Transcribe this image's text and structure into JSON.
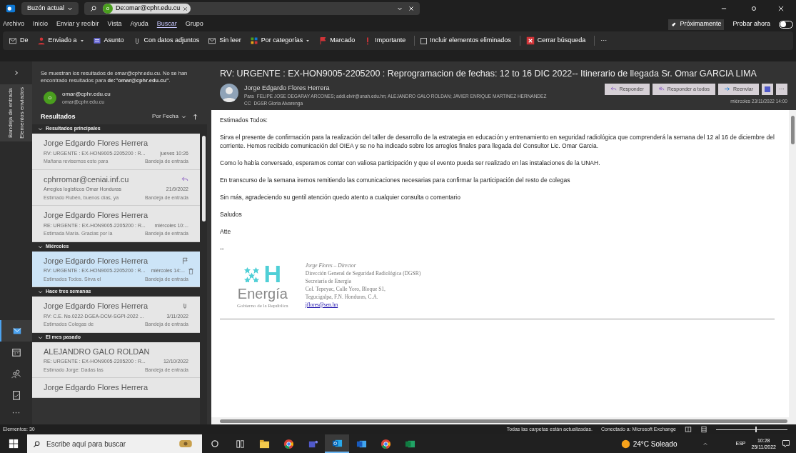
{
  "title_bar": {
    "scope": "Buzón actual",
    "search_chip": {
      "initial": "o",
      "text": "De:omar@cphr.edu.cu"
    }
  },
  "menu": {
    "items": [
      {
        "label": "Archivo",
        "selected": false
      },
      {
        "label": "Inicio",
        "selected": false
      },
      {
        "label": "Enviar y recibir",
        "selected": false
      },
      {
        "label": "Vista",
        "selected": false
      },
      {
        "label": "Ayuda",
        "selected": false
      },
      {
        "label": "Buscar",
        "selected": true
      },
      {
        "label": "Grupo",
        "selected": false
      }
    ],
    "coming_soon": "Próximamente",
    "try_now": "Probar ahora",
    "try_now_on": false
  },
  "ribbon": [
    {
      "kind": "envelope",
      "label": "De",
      "dropdown": false
    },
    {
      "kind": "person",
      "label": "Enviado a",
      "dropdown": true
    },
    {
      "kind": "subject",
      "label": "Asunto",
      "dropdown": false
    },
    {
      "kind": "clip",
      "label": "Con datos adjuntos",
      "dropdown": false
    },
    {
      "kind": "envelope",
      "label": "Sin leer",
      "dropdown": false
    },
    {
      "kind": "categories",
      "label": "Por categorías",
      "dropdown": true
    },
    {
      "kind": "flag",
      "label": "Marcado",
      "dropdown": false
    },
    {
      "kind": "important",
      "label": "Importante",
      "dropdown": false
    },
    {
      "kind": "checkbox",
      "label": "Incluir elementos eliminados",
      "checked": false
    },
    {
      "kind": "close",
      "label": "Cerrar búsqueda",
      "dropdown": false
    },
    {
      "kind": "more",
      "label": "···"
    }
  ],
  "nav_rail": {
    "folders": [
      "Bandeja de entrada",
      "Elementos enviados"
    ],
    "apps": [
      {
        "kind": "mail",
        "selected": true
      },
      {
        "kind": "calendar",
        "selected": false
      },
      {
        "kind": "people",
        "selected": false
      },
      {
        "kind": "tasks",
        "selected": false
      },
      {
        "kind": "more",
        "selected": false
      }
    ],
    "more_label": "···"
  },
  "search_panel": {
    "notice": "Se muestran los resultados de omar@cphr.edu.cu. No se han encontrado resultados para **de:\"omar@cphr.edu.cu\"**.",
    "contact": {
      "initial": "o",
      "name": "omar@cphr.edu.cu",
      "email": "omar@cphr.edu.cu"
    },
    "results_label": "Resultados",
    "sort": "Por Fecha",
    "groups": [
      {
        "title": "Resultados principales",
        "expanded": true,
        "items": [
          {
            "sender": "Jorge Edgardo Flores Herrera",
            "subject": "RV: URGENTE : EX-HON9005-2205200 : R...",
            "date": "jueves 10:26",
            "preview": "Mañana revisemos esto para",
            "folder": "Bandeja de entrada",
            "replied": false,
            "flagged": false,
            "attachment": false,
            "selected": false
          },
          {
            "sender": "cphrromar@ceniai.inf.cu",
            "subject": "Arreglos logísticos Omar Honduras",
            "date": "21/9/2022",
            "preview": "Estimado Rubén, buenos días, ya",
            "folder": "Bandeja de entrada",
            "replied": true,
            "flagged": false,
            "attachment": false,
            "selected": false
          },
          {
            "sender": "Jorge Edgardo Flores Herrera",
            "subject": "RE: URGENTE : EX-HON9005-2205200 : R...",
            "date": "miércoles 10:...",
            "preview": "Estimada María. Gracias por la",
            "folder": "Bandeja de entrada",
            "replied": false,
            "flagged": false,
            "attachment": false,
            "selected": false
          }
        ]
      },
      {
        "title": "Miércoles",
        "expanded": true,
        "items": [
          {
            "sender": "Jorge Edgardo Flores Herrera",
            "subject": "RV: URGENTE : EX-HON9005-2205200 : R...",
            "date": "miércoles 14:...",
            "preview": "Estimados Todos. Sirva el",
            "folder": "Bandeja de entrada",
            "replied": false,
            "flagged": true,
            "attachment": false,
            "selected": true
          }
        ]
      },
      {
        "title": "Hace tres semanas",
        "expanded": true,
        "items": [
          {
            "sender": "Jorge Edgardo Flores Herrera",
            "subject": "RV: C.E. No.0222-DGEA-DCM-SGPI-2022 ...",
            "date": "3/11/2022",
            "preview": "Estimados Colegas de",
            "folder": "Bandeja de entrada",
            "replied": false,
            "flagged": false,
            "attachment": true,
            "selected": false
          }
        ]
      },
      {
        "title": "El mes pasado",
        "expanded": true,
        "items": [
          {
            "sender": "ALEJANDRO GALO ROLDAN",
            "subject": "RE: URGENTE : EX-HON9005-2205200 : R...",
            "date": "12/10/2022",
            "preview": "Estimado Jorge: Dadas las",
            "folder": "Bandeja de entrada",
            "replied": false,
            "flagged": false,
            "attachment": false,
            "selected": false
          },
          {
            "sender": "Jorge Edgardo Flores Herrera",
            "replied": false,
            "flagged": false,
            "attachment": false,
            "selected": false
          }
        ]
      }
    ]
  },
  "message": {
    "subject": "RV: URGENTE : EX-HON9005-2205200 : Reprogramacion de fechas: 12 to 16 DIC 2022-- Itinerario de llegada Sr. Omar GARCIA LIMA",
    "sender": "Jorge Edgardo Flores Herrera",
    "to_label": "Para",
    "to": "FELIPE JOSE DEGARAY ARCONES; addi.elvir@unah.edu.hn; ALEJANDRO GALO ROLDAN; JAVIER ENRIQUE MARTINEZ HERNANDEZ",
    "cc_label": "CC",
    "cc": "DGSR Gloria Alvarenga",
    "date": "miércoles 23/11/2022 14:00",
    "actions": [
      {
        "kind": "reply",
        "label": "Responder"
      },
      {
        "kind": "reply_all",
        "label": "Responder a todos"
      },
      {
        "kind": "forward",
        "label": "Reenviar"
      }
    ],
    "more": "···",
    "body": [
      "Estimados Todos:",
      "Sirva el presente de confirmación para la realización del taller de desarrollo de la estrategia en educación y entrenamiento en seguridad radiológica que comprenderá la semana del 12 al 16 de diciembre del corriente. Hemos recibido comunicación del OIEA y se no ha indicado sobre los arreglos finales para llegada del Consultor Lic. Omar Garcia.",
      "Como lo había conversado, esperamos contar con valiosa participación y que el evento pueda ser realizado en las instalaciones de la UNAH.",
      "En transcurso de la semana iremos remitiendo las comunicaciones necesarias para confirmar la participación del resto de colegas",
      "Sin más, agradeciendo su gentil atención quedo atento a cualquier consulta o comentario",
      "Saludos",
      "Atte",
      "--"
    ],
    "signature": {
      "logo_letter": "H",
      "logo_word": "Energía",
      "logo_caption": "Gobierno de la República",
      "name": "Jorge Flores – Director",
      "lines": [
        "Dirección General de Seguridad Radiológica (DGSR)",
        "Secretaría de Energía",
        "Col. Tepeyac, Calle Yoro, Bloque S1,",
        "Tegucigalpa, F.N. Honduras, C.A."
      ],
      "email": "jflores@sen.hn"
    }
  },
  "status_bar": {
    "count": "Elementos: 30",
    "sync": "Todas las carpetas están actualizadas.",
    "connection": "Conectado a: Microsoft Exchange",
    "zoom": {
      "level": 0.55
    }
  },
  "taskbar": {
    "search_placeholder": "Escribe aquí para buscar",
    "apps": [
      {
        "kind": "taskview",
        "active": false
      },
      {
        "kind": "files",
        "active": false
      },
      {
        "kind": "chrome",
        "active": false
      },
      {
        "kind": "teams",
        "active": false
      },
      {
        "kind": "outlook",
        "active": true
      },
      {
        "kind": "word",
        "active": false
      },
      {
        "kind": "chrome2",
        "active": false
      },
      {
        "kind": "excel",
        "active": false
      }
    ],
    "weather": "24°C Soleado",
    "language": "ESP",
    "time": "10:28",
    "date": "25/11/2022"
  }
}
